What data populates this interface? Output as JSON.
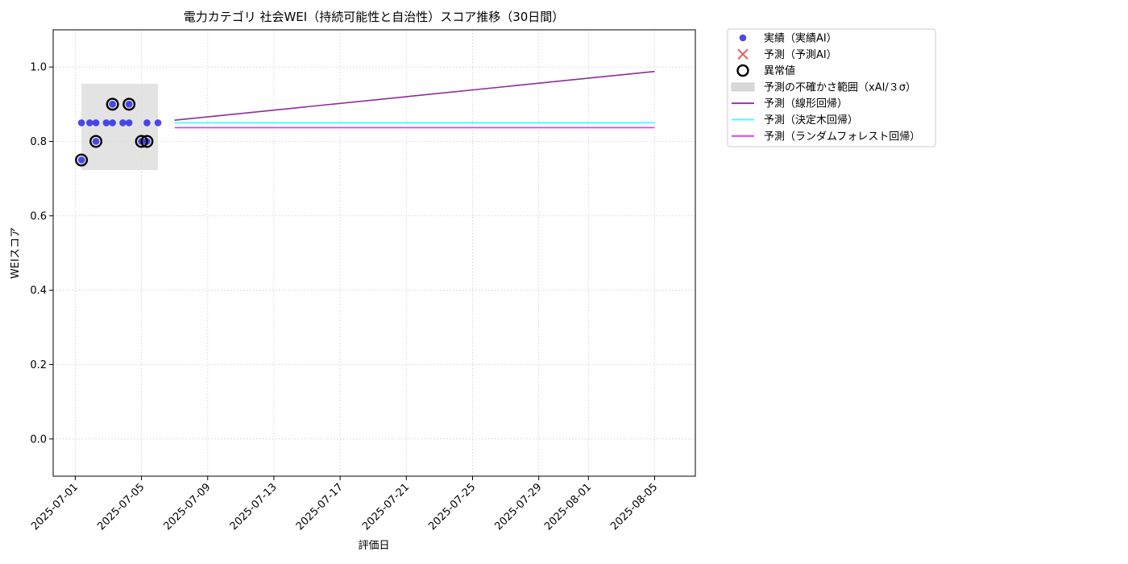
{
  "chart_data": {
    "type": "scatter",
    "title": "電力カテゴリ 社会WEI（持続可能性と自治性）スコア推移（30日間）",
    "xlabel": "評価日",
    "ylabel": "WEIスコア",
    "x_ticks": [
      "2025-07-01",
      "2025-07-05",
      "2025-07-09",
      "2025-07-13",
      "2025-07-17",
      "2025-07-21",
      "2025-07-25",
      "2025-07-29",
      "2025-08-01",
      "2025-08-05"
    ],
    "y_ticks": [
      "0.0",
      "0.2",
      "0.4",
      "0.6",
      "0.8",
      "1.0"
    ],
    "ylim": [
      -0.1,
      1.1
    ],
    "grid": true,
    "legend_position": "outside-right",
    "series": [
      {
        "name": "実績（実績AI）",
        "kind": "scatter",
        "color": "#2a2ae8",
        "points": [
          {
            "x": "2025-07-01T09:00",
            "y": 0.75
          },
          {
            "x": "2025-07-01T09:00",
            "y": 0.85
          },
          {
            "x": "2025-07-01T21:00",
            "y": 0.85
          },
          {
            "x": "2025-07-02T06:00",
            "y": 0.85
          },
          {
            "x": "2025-07-02T06:00",
            "y": 0.8
          },
          {
            "x": "2025-07-02T21:00",
            "y": 0.85
          },
          {
            "x": "2025-07-03T06:00",
            "y": 0.9
          },
          {
            "x": "2025-07-03T06:00",
            "y": 0.85
          },
          {
            "x": "2025-07-03T21:00",
            "y": 0.85
          },
          {
            "x": "2025-07-04T06:00",
            "y": 0.85
          },
          {
            "x": "2025-07-04T06:00",
            "y": 0.9
          },
          {
            "x": "2025-07-05T00:00",
            "y": 0.8
          },
          {
            "x": "2025-07-05T08:00",
            "y": 0.85
          },
          {
            "x": "2025-07-05T08:00",
            "y": 0.8
          },
          {
            "x": "2025-07-06T00:00",
            "y": 0.85
          }
        ]
      },
      {
        "name": "予測（予測AI）",
        "kind": "cross",
        "color": "#f03c3c",
        "points": []
      },
      {
        "name": "異常値",
        "kind": "ring",
        "color": "#000000",
        "points": [
          {
            "x": "2025-07-01T09:00",
            "y": 0.75
          },
          {
            "x": "2025-07-02T06:00",
            "y": 0.8
          },
          {
            "x": "2025-07-03T06:00",
            "y": 0.9
          },
          {
            "x": "2025-07-04T06:00",
            "y": 0.9
          },
          {
            "x": "2025-07-05T00:00",
            "y": 0.8
          },
          {
            "x": "2025-07-05T08:00",
            "y": 0.8
          }
        ]
      },
      {
        "name": "予測の不確かさ範囲（xAI/３σ）",
        "kind": "band",
        "color": "#d9d9d9",
        "x_start": "2025-07-01T09:00",
        "x_end": "2025-07-06T00:00",
        "y_low": 0.723,
        "y_high": 0.955
      },
      {
        "name": "予測（線形回帰）",
        "kind": "line",
        "color": "#8e2c9a",
        "points": [
          {
            "x": "2025-07-07T00:00",
            "y": 0.857
          },
          {
            "x": "2025-08-05T00:00",
            "y": 0.988
          }
        ]
      },
      {
        "name": "予測（決定木回帰）",
        "kind": "line",
        "color": "#33ffff",
        "points": [
          {
            "x": "2025-07-07T00:00",
            "y": 0.85
          },
          {
            "x": "2025-08-05T00:00",
            "y": 0.85
          }
        ]
      },
      {
        "name": "予測（ランダムフォレスト回帰）",
        "kind": "line",
        "color": "#ee33ee",
        "points": [
          {
            "x": "2025-07-07T00:00",
            "y": 0.837
          },
          {
            "x": "2025-08-05T00:00",
            "y": 0.837
          }
        ]
      }
    ]
  }
}
